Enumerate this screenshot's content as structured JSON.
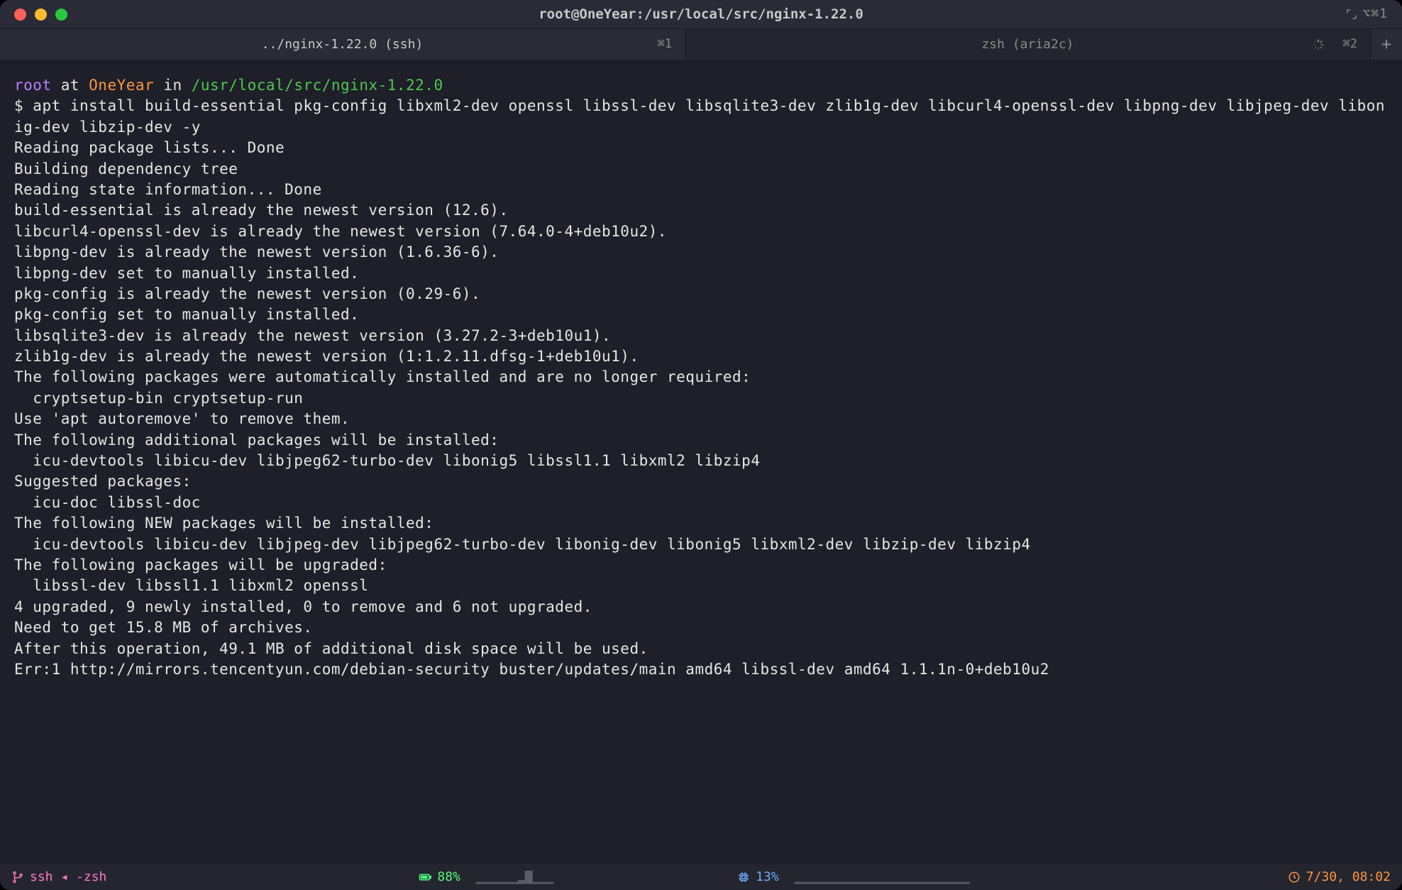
{
  "titlebar": {
    "title": "root@OneYear:/usr/local/src/nginx-1.22.0",
    "right_hint": "⌥⌘1"
  },
  "tabs": [
    {
      "label": "../nginx-1.22.0 (ssh)",
      "hotkey": "⌘1",
      "active": true
    },
    {
      "label": "zsh (aria2c)",
      "hotkey": "⌘2",
      "active": false,
      "spinner": true
    }
  ],
  "prompt": {
    "user": "root",
    "at": " at ",
    "host": "OneYear",
    "in": " in ",
    "path": "/usr/local/src/nginx-1.22.0"
  },
  "command_sigil": "$ ",
  "command": "apt install build-essential pkg-config libxml2-dev openssl libssl-dev libsqlite3-dev zlib1g-dev libcurl4-openssl-dev libpng-dev libjpeg-dev libonig-dev libzip-dev -y",
  "output_lines": [
    "Reading package lists... Done",
    "Building dependency tree",
    "Reading state information... Done",
    "build-essential is already the newest version (12.6).",
    "libcurl4-openssl-dev is already the newest version (7.64.0-4+deb10u2).",
    "libpng-dev is already the newest version (1.6.36-6).",
    "libpng-dev set to manually installed.",
    "pkg-config is already the newest version (0.29-6).",
    "pkg-config set to manually installed.",
    "libsqlite3-dev is already the newest version (3.27.2-3+deb10u1).",
    "zlib1g-dev is already the newest version (1:1.2.11.dfsg-1+deb10u1).",
    "The following packages were automatically installed and are no longer required:",
    "  cryptsetup-bin cryptsetup-run",
    "Use 'apt autoremove' to remove them.",
    "The following additional packages will be installed:",
    "  icu-devtools libicu-dev libjpeg62-turbo-dev libonig5 libssl1.1 libxml2 libzip4",
    "Suggested packages:",
    "  icu-doc libssl-doc",
    "The following NEW packages will be installed:",
    "  icu-devtools libicu-dev libjpeg-dev libjpeg62-turbo-dev libonig-dev libonig5 libxml2-dev libzip-dev libzip4",
    "The following packages will be upgraded:",
    "  libssl-dev libssl1.1 libxml2 openssl",
    "4 upgraded, 9 newly installed, 0 to remove and 6 not upgraded.",
    "Need to get 15.8 MB of archives.",
    "After this operation, 49.1 MB of additional disk space will be used.",
    "Err:1 http://mirrors.tencentyun.com/debian-security buster/updates/main amd64 libssl-dev amd64 1.1.1n-0+deb10u2"
  ],
  "statusbar": {
    "process": "ssh ◂ -zsh",
    "battery_pct": "88%",
    "battery_spark": "▁▁▁▁▁▁▂▇▁▁▁",
    "cpu_pct": "13%",
    "cpu_spark": "▁▁▁▁▁▁▁▁▁▁▁▁▁▁▁▁▁▁▁▁▁▁▁▁▁",
    "time": "7/30, 08:02"
  },
  "icons": {
    "branch": "⎇"
  }
}
